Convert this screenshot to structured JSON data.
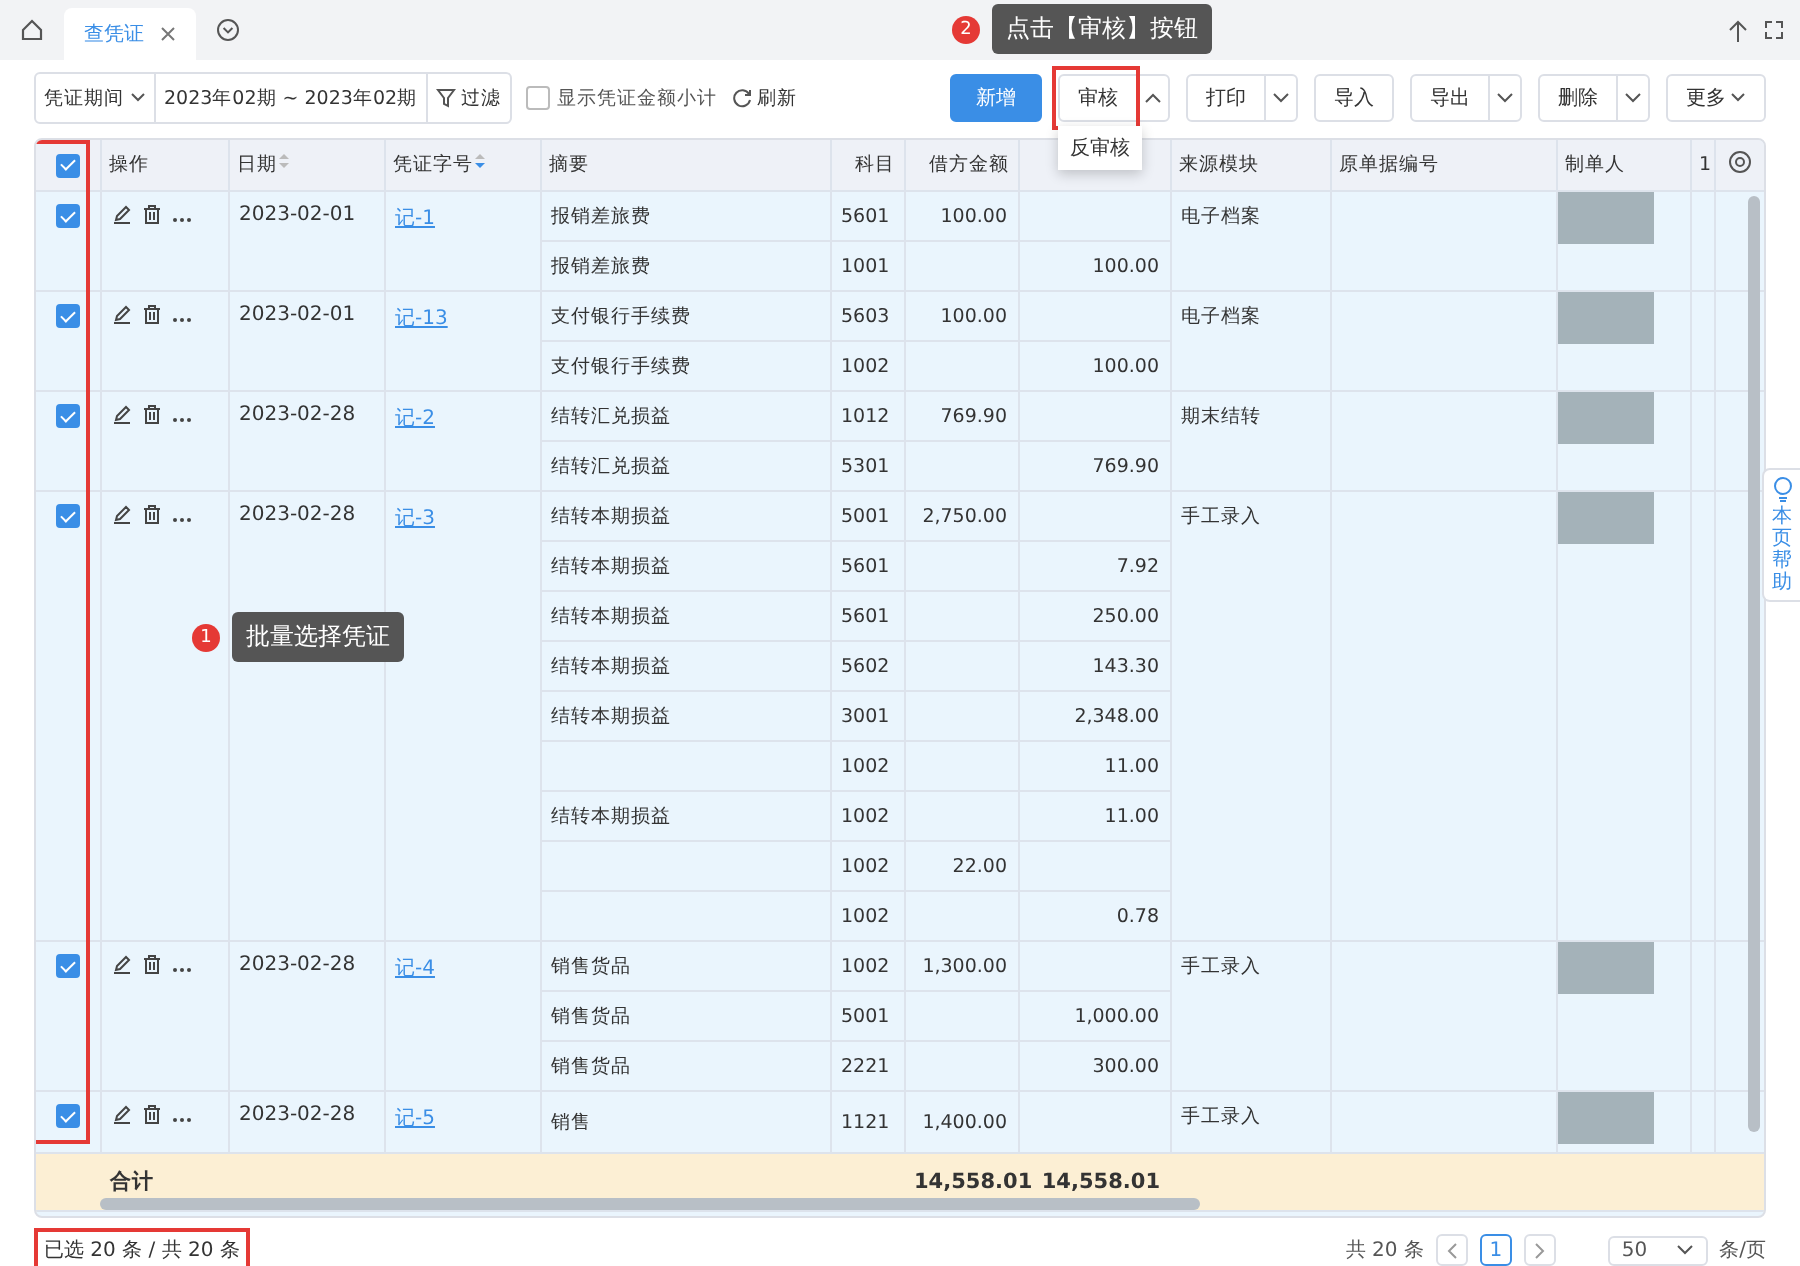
{
  "tabs": [
    {
      "label": "查凭证",
      "selected": true
    }
  ],
  "callouts": [
    {
      "number": "2",
      "text": "点击【审核】按钮"
    },
    {
      "number": "1",
      "text": "批量选择凭证"
    }
  ],
  "toolbar": {
    "period_label": "凭证期间",
    "period_value": "2023年02期 ~ 2023年02期",
    "filter": "过滤",
    "subtotal": {
      "label": "显示凭证金额小计",
      "checked": false
    },
    "refresh": "刷新",
    "buttons": [
      {
        "label": "新增",
        "kind": "primary"
      },
      {
        "label": "审核",
        "kind": "split-up"
      },
      {
        "label": "打印",
        "kind": "split"
      },
      {
        "label": "导入",
        "kind": "plain"
      },
      {
        "label": "导出",
        "kind": "split"
      },
      {
        "label": "删除",
        "kind": "split"
      },
      {
        "label": "更多",
        "kind": "menu"
      }
    ],
    "menu": [
      "反审核"
    ]
  },
  "table": {
    "columns": [
      {
        "label": "操作"
      },
      {
        "label": "日期"
      },
      {
        "label": "凭证字号"
      },
      {
        "label": "摘要"
      },
      {
        "label": "科目"
      },
      {
        "label": "借方金额"
      },
      {},
      {
        "label": "来源模块"
      },
      {
        "label": "原单据编号"
      },
      {
        "label": "制单人"
      },
      {
        "label": "1"
      }
    ],
    "all_checked": true,
    "vouchers": [
      {
        "checked": true,
        "date": "2023-02-01",
        "number": "记-1",
        "source": "电子档案",
        "entries": [
          {
            "summary": "报销差旅费",
            "account": "5601",
            "debit": "100.00"
          },
          {
            "summary": "报销差旅费",
            "account": "1001",
            "credit": "100.00"
          }
        ]
      },
      {
        "checked": true,
        "date": "2023-02-01",
        "number": "记-13",
        "source": "电子档案",
        "entries": [
          {
            "summary": "支付银行手续费",
            "account": "5603",
            "debit": "100.00"
          },
          {
            "summary": "支付银行手续费",
            "account": "1002",
            "credit": "100.00"
          }
        ]
      },
      {
        "checked": true,
        "date": "2023-02-28",
        "number": "记-2",
        "source": "期末结转",
        "entries": [
          {
            "summary": "结转汇兑损益",
            "account": "1012",
            "debit": "769.90"
          },
          {
            "summary": "结转汇兑损益",
            "account": "5301",
            "credit": "769.90"
          }
        ]
      },
      {
        "checked": true,
        "date": "2023-02-28",
        "number": "记-3",
        "source": "手工录入",
        "entries": [
          {
            "summary": "结转本期损益",
            "account": "5001",
            "debit": "2,750.00"
          },
          {
            "summary": "结转本期损益",
            "account": "5601",
            "credit": "7.92"
          },
          {
            "summary": "结转本期损益",
            "account": "5601",
            "credit": "250.00"
          },
          {
            "summary": "结转本期损益",
            "account": "5602",
            "credit": "143.30"
          },
          {
            "summary": "结转本期损益",
            "account": "3001",
            "credit": "2,348.00"
          },
          {
            "account": "1002",
            "credit": "11.00"
          },
          {
            "summary": "结转本期损益",
            "account": "1002",
            "credit": "11.00"
          },
          {
            "account": "1002",
            "debit": "22.00"
          },
          {
            "account": "1002",
            "credit": "0.78"
          }
        ]
      },
      {
        "checked": true,
        "date": "2023-02-28",
        "number": "记-4",
        "source": "手工录入",
        "entries": [
          {
            "summary": "销售货品",
            "account": "1002",
            "debit": "1,300.00"
          },
          {
            "summary": "销售货品",
            "account": "5001",
            "credit": "1,000.00"
          },
          {
            "summary": "销售货品",
            "account": "2221",
            "credit": "300.00"
          }
        ]
      },
      {
        "checked": true,
        "date": "2023-02-28",
        "number": "记-5",
        "source": "手工录入",
        "entries": [
          {
            "summary": "销售",
            "account": "1121",
            "debit": "1,400.00"
          }
        ]
      }
    ],
    "total": {
      "label": "合计",
      "debit": "14,558.01",
      "credit": "14,558.01"
    }
  },
  "footer": {
    "selection": "已选 20 条 / 共 20 条",
    "count": "共 20 条",
    "pages": [
      {
        "label": "1",
        "selected": true
      }
    ],
    "page_size": "50",
    "page_size_unit": "条/页"
  },
  "help": "本页帮助"
}
